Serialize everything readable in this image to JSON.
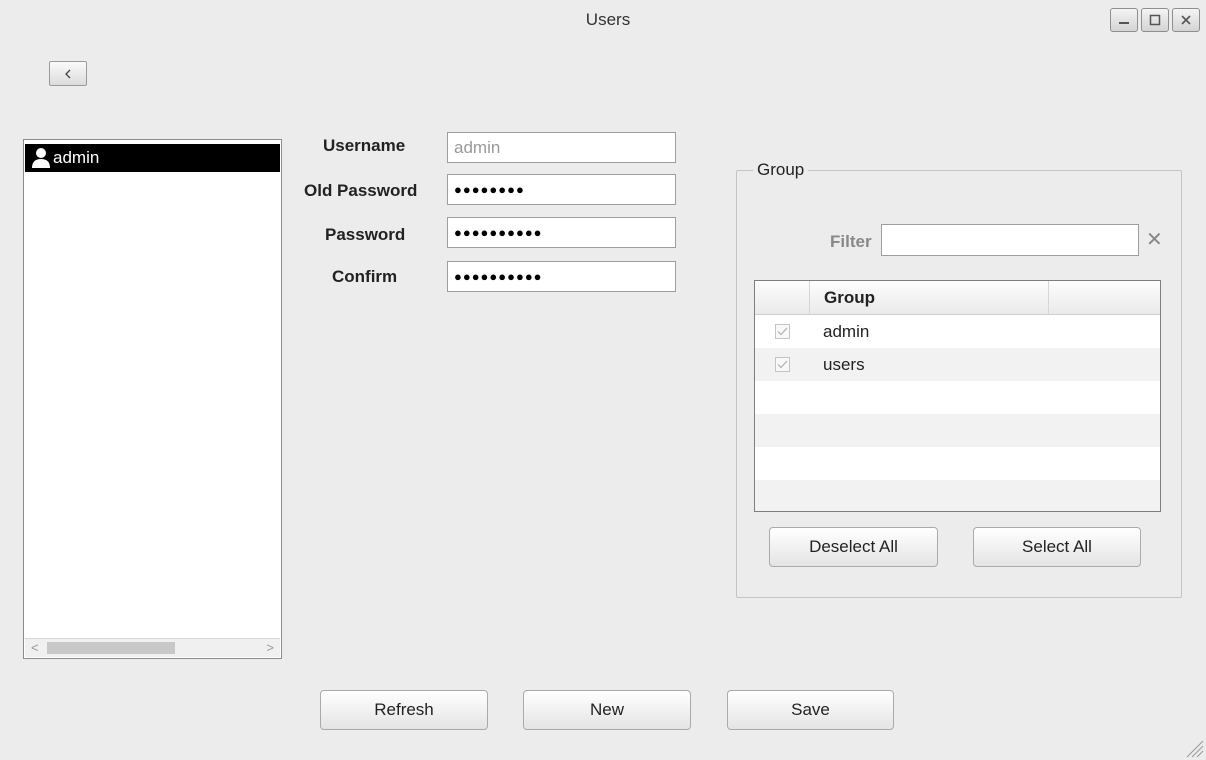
{
  "window": {
    "title": "Users"
  },
  "users": [
    {
      "name": "admin",
      "selected": true
    }
  ],
  "form": {
    "username_label": "Username",
    "username_value": "admin",
    "old_password_label": "Old Password",
    "old_password_value": "●●●●●●●●",
    "password_label": "Password",
    "password_value": "●●●●●●●●●●",
    "confirm_label": "Confirm",
    "confirm_value": "●●●●●●●●●●"
  },
  "group_panel": {
    "legend": "Group",
    "filter_label": "Filter",
    "filter_value": "",
    "table_header": "Group",
    "rows": [
      {
        "name": "admin",
        "checked": true
      },
      {
        "name": "users",
        "checked": true
      }
    ],
    "deselect_all_label": "Deselect All",
    "select_all_label": "Select All"
  },
  "footer": {
    "refresh_label": "Refresh",
    "new_label": "New",
    "save_label": "Save"
  }
}
